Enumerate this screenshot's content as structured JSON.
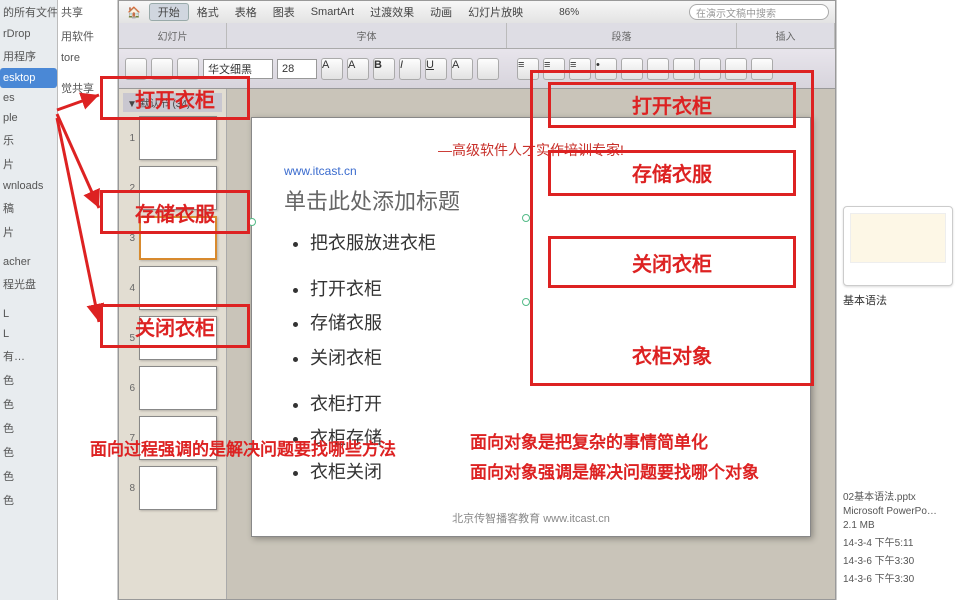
{
  "finder": {
    "col1": [
      "的所有文件",
      "rDrop",
      "用程序",
      "esktop",
      "es",
      "ple",
      "乐",
      "片",
      "wnloads",
      "稿",
      "片",
      "",
      "acher",
      "程光盘",
      "",
      "L",
      "L",
      "有…",
      "",
      "色",
      "色",
      "色",
      "色",
      "色",
      "色"
    ],
    "col1_selected_index": 3,
    "col2": [
      "共享",
      "用软件",
      "tore",
      "",
      "觉共享"
    ]
  },
  "ppt": {
    "zoom": "86%",
    "search_placeholder": "在演示文稿中搜索",
    "tabs": [
      "开始",
      "格式",
      "",
      "表格",
      "图表",
      "SmartArt",
      "过渡效果",
      "动画",
      "幻灯片放映"
    ],
    "active_tab_index": 0,
    "groups": {
      "g1": "幻灯片",
      "g2": "字体",
      "g3": "段落",
      "g4": "插入"
    },
    "font_name": "华文细黑",
    "font_size": "28",
    "outline_header": "▼ 默认节 (34)",
    "thumb_numbers": [
      "1",
      "2",
      "3",
      "4",
      "5",
      "6",
      "7",
      "8"
    ],
    "selected_thumb": 2,
    "slide": {
      "banner": "—高级软件人才实作培训专家!",
      "url": "www.itcast.cn",
      "title": "单击此处添加标题",
      "bullets_a": [
        "把衣服放进衣柜"
      ],
      "bullets_b": [
        "打开衣柜",
        "存储衣服",
        "关闭衣柜"
      ],
      "bullets_c": [
        "衣柜打开",
        "衣柜存储",
        "衣柜关闭"
      ],
      "footer": "北京传智播客教育 www.itcast.cn"
    }
  },
  "annotations": {
    "left_labels": [
      "打开衣柜",
      "存储衣服",
      "关闭衣柜"
    ],
    "right_labels": [
      "打开衣柜",
      "存储衣服",
      "关闭衣柜",
      "衣柜对象"
    ],
    "caption_left": "面向过程强调的是解决问题要找哪些方法",
    "caption_right_1": "面向对象是把复杂的事情简单化",
    "caption_right_2": "面向对象强调是解决问题要找哪个对象"
  },
  "preview": {
    "label1": "基本语法",
    "filename": "02基本语法.pptx",
    "app": "Microsoft PowerPo…",
    "size": "2.1 MB",
    "date1": "14-3-4 下午5:11",
    "date2": "14-3-6 下午3:30",
    "date3": "14-3-6 下午3:30"
  }
}
